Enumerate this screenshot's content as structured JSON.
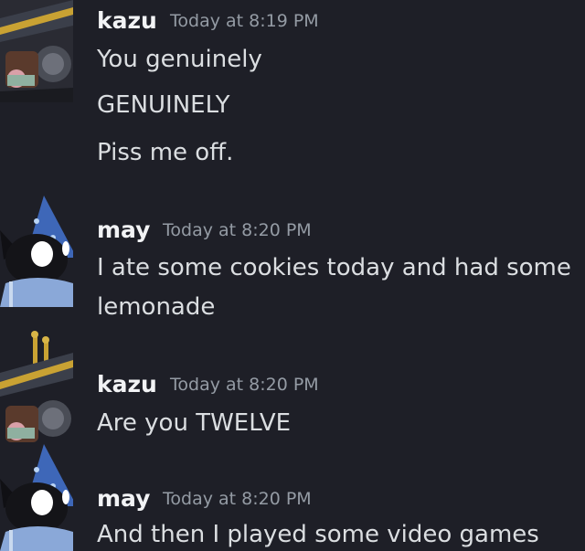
{
  "colors": {
    "background": "#1e1f27",
    "username": "#f2f3f5",
    "timestamp": "#949ba4",
    "message_text": "#dbdee1"
  },
  "messages": [
    {
      "author": "kazu",
      "timestamp": "Today at 8:19 PM",
      "avatar_icon": "robot-samurai-avatar-icon",
      "lines": [
        "You genuinely",
        "GENUINELY",
        "Piss me off."
      ]
    },
    {
      "author": "may",
      "timestamp": "Today at 8:20 PM",
      "avatar_icon": "wizard-cat-avatar-icon",
      "lines": [
        "I ate some cookies today and had some",
        "lemonade"
      ]
    },
    {
      "author": "kazu",
      "timestamp": "Today at 8:20 PM",
      "avatar_icon": "robot-samurai-avatar-icon",
      "lines": [
        "Are you TWELVE"
      ]
    },
    {
      "author": "may",
      "timestamp": "Today at 8:20 PM",
      "avatar_icon": "wizard-cat-avatar-icon",
      "lines": [
        "And then I played some video games"
      ]
    }
  ]
}
